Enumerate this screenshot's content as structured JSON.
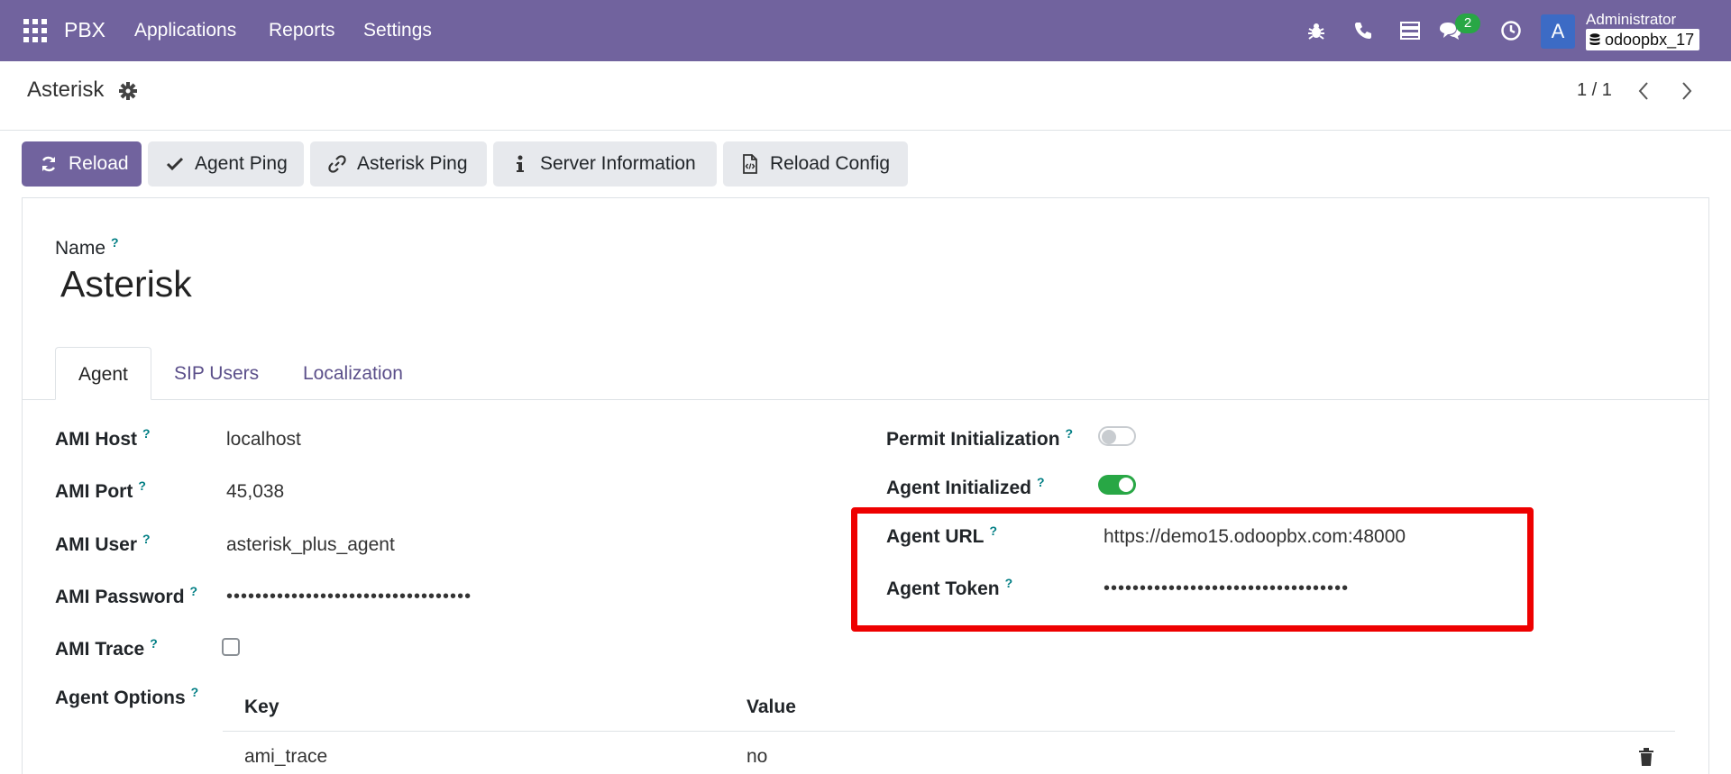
{
  "navbar": {
    "app_name": "PBX",
    "menus": [
      "Applications",
      "Reports",
      "Settings"
    ],
    "messages_badge": "2",
    "avatar_letter": "A",
    "user_name": "Administrator",
    "database": "odoopbx_17",
    "icons": [
      "bug-icon",
      "phone-icon",
      "server-icon",
      "chat-icon",
      "clock-icon"
    ],
    "brand_color": "#71639e"
  },
  "control_panel": {
    "breadcrumb": "Asterisk",
    "pager": "1 / 1"
  },
  "actions": {
    "reload": "Reload",
    "agent_ping": "Agent Ping",
    "asterisk_ping": "Asterisk Ping",
    "server_information": "Server Information",
    "reload_config": "Reload Config"
  },
  "form": {
    "name_label": "Name",
    "name_value": "Asterisk",
    "help_mark": "?",
    "tabs": [
      "Agent",
      "SIP Users",
      "Localization"
    ],
    "left": {
      "ami_host_label": "AMI Host",
      "ami_host_value": "localhost",
      "ami_port_label": "AMI Port",
      "ami_port_value": "45,038",
      "ami_user_label": "AMI User",
      "ami_user_value": "asterisk_plus_agent",
      "ami_password_label": "AMI Password",
      "ami_password_value": "••••••••••••••••••••••••••••••••••",
      "ami_trace_label": "AMI Trace",
      "ami_trace_checked": false,
      "agent_options_label": "Agent Options"
    },
    "right": {
      "permit_init_label": "Permit Initialization",
      "permit_init_on": false,
      "agent_init_label": "Agent Initialized",
      "agent_init_on": true,
      "agent_url_label": "Agent URL",
      "agent_url_value": "https://demo15.odoopbx.com:48000",
      "agent_token_label": "Agent Token",
      "agent_token_value": "••••••••••••••••••••••••••••••••••"
    },
    "options_table": {
      "headers": [
        "Key",
        "Value"
      ],
      "rows": [
        {
          "key": "ami_trace",
          "value": "no"
        }
      ]
    }
  }
}
